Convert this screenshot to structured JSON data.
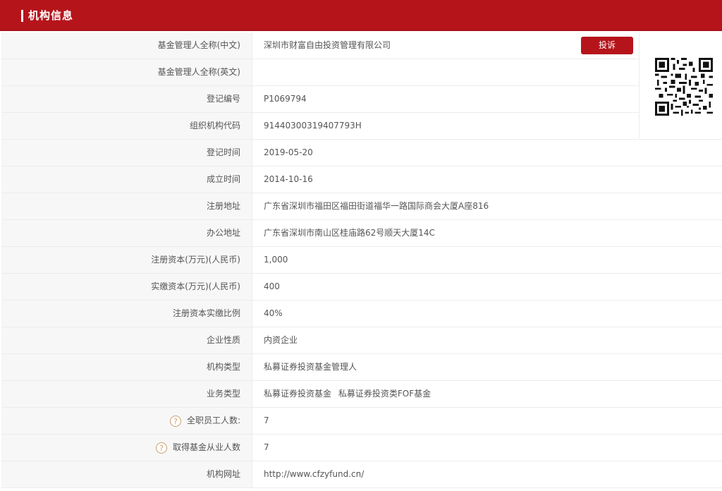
{
  "header": {
    "title": "机构信息"
  },
  "complaint_label": "投诉",
  "qr_icon": "qr-code",
  "rows": [
    {
      "label": "基金管理人全称(中文)",
      "value": "深圳市财富自由投资管理有限公司"
    },
    {
      "label": "基金管理人全称(英文)",
      "value": ""
    },
    {
      "label": "登记编号",
      "value": "P1069794"
    },
    {
      "label": "组织机构代码",
      "value": "91440300319407793H"
    },
    {
      "label": "登记时间",
      "value": "2019-05-20"
    },
    {
      "label": "成立时间",
      "value": "2014-10-16"
    },
    {
      "label": "注册地址",
      "value": "广东省深圳市福田区福田街道福华一路国际商会大厦A座816"
    },
    {
      "label": "办公地址",
      "value": "广东省深圳市南山区桂庙路62号顺天大厦14C"
    },
    {
      "label": "注册资本(万元)(人民币)",
      "value": "1,000"
    },
    {
      "label": "实缴资本(万元)(人民币)",
      "value": "400"
    },
    {
      "label": "注册资本实缴比例",
      "value": "40%"
    },
    {
      "label": "企业性质",
      "value": "内资企业"
    },
    {
      "label": "机构类型",
      "value": "私募证券投资基金管理人"
    },
    {
      "label": "业务类型",
      "value": "私募证券投资基金",
      "value2": "私募证券投资类FOF基金"
    },
    {
      "label": "全职员工人数:",
      "value": "7",
      "help_icon": "?"
    },
    {
      "label": "取得基金从业人数",
      "value": "7",
      "help_icon": "?"
    },
    {
      "label": "机构网址",
      "value": "http://www.cfzyfund.cn/"
    }
  ]
}
